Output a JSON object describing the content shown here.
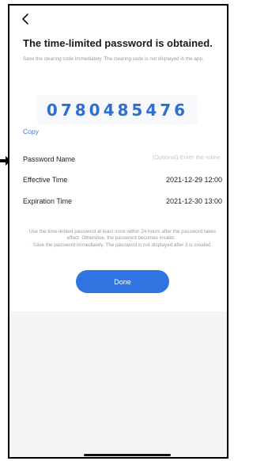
{
  "header": {
    "back_icon": "chevron-left-icon",
    "title": "The time-limited password is obtained.",
    "subtitle": "Save the clearing code immediately. The clearing code is not displayed in the app."
  },
  "code": {
    "value": "0780485476"
  },
  "copy": {
    "label": "Copy"
  },
  "fields": {
    "password_name": {
      "label": "Password Name",
      "value": "",
      "placeholder": "(Optional) Enter the name."
    },
    "effective_time": {
      "label": "Effective Time",
      "value": "2021-12-29 12:00"
    },
    "expiration_time": {
      "label": "Expiration Time",
      "value": "2021-12-30 13:00"
    }
  },
  "notes": {
    "line1": "· Use the time-limited password at least once within 24 hours after the password takes effect. Otherwise, the password becomes invalid.",
    "line2": "· Save the password immediately. The password is not displayed after it is created."
  },
  "actions": {
    "done_label": "Done"
  },
  "colors": {
    "accent": "#2f74e0",
    "code": "#2d6fcf",
    "link": "#3b7ddd"
  }
}
